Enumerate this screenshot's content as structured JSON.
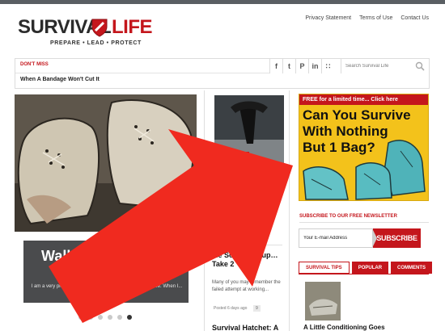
{
  "header": {
    "logo": {
      "word1": "SURVIVAL",
      "word2": "LIFE",
      "tagline": "PREPARE • LEAD • PROTECT"
    },
    "links": [
      "Privacy Statement",
      "Terms of Use",
      "Contact Us"
    ]
  },
  "nav": {
    "dont_miss": "DON'T MISS",
    "ticker": "When A Bandage Won't Cut It",
    "social": [
      {
        "icon": "facebook-icon",
        "glyph": "f"
      },
      {
        "icon": "twitter-icon",
        "glyph": "t"
      },
      {
        "icon": "pinterest-icon",
        "glyph": "P"
      },
      {
        "icon": "linkedin-icon",
        "glyph": "in"
      },
      {
        "icon": "rss-icon",
        "glyph": "∷"
      }
    ],
    "search_placeholder": "Search Survival Life"
  },
  "slider": {
    "caption_title": "Walki",
    "caption_text": "I am a very picky person  my shoes, even more than my wife. When I...",
    "dots": 6,
    "active_dot": 5
  },
  "middle": {
    "thumb_label": "Covert",
    "partial_letter": "o",
    "count1": "18",
    "title2": "ale Solar Backup…Take 2",
    "excerpt": "Many of you may remember the failed attempt at working...",
    "meta": "Posted 6 days ago",
    "count2": "9",
    "title3": "Survival Hatchet: A"
  },
  "ad": {
    "banner": "FREE for a limited time... Click here",
    "headline_lines": [
      "Can You Survive",
      "With Nothing",
      "But 1 Bag?"
    ]
  },
  "newsletter": {
    "label": "SUBSCRIBE TO OUR FREE NEWSLETTER",
    "placeholder": "Your E-mail Address",
    "button": "SUBSCRIBE"
  },
  "tabs": {
    "items": [
      "SURVIVAL TIPS",
      "POPULAR",
      "COMMENTS"
    ],
    "first_title": "A Little Conditioning Goes"
  },
  "colors": {
    "brand_red": "#c4161c",
    "ad_yellow": "#f3c21b",
    "caption_gray": "#4a4b4d"
  }
}
